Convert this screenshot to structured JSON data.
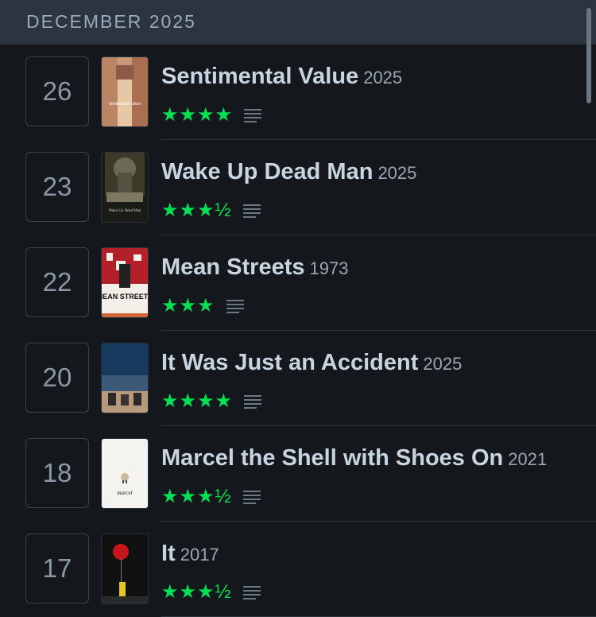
{
  "header": {
    "month": "DECEMBER 2025"
  },
  "entries": [
    {
      "day": "26",
      "title": "Sentimental Value",
      "year": "2025",
      "stars": "★★★★",
      "poster_text": "Sentimental Value"
    },
    {
      "day": "23",
      "title": "Wake Up Dead Man",
      "year": "2025",
      "stars": "★★★½",
      "poster_text": "Wake Up Dead Man"
    },
    {
      "day": "22",
      "title": "Mean Streets",
      "year": "1973",
      "stars": "★★★",
      "poster_text": "MEAN STREETS"
    },
    {
      "day": "20",
      "title": "It Was Just an Accident",
      "year": "2025",
      "stars": "★★★★",
      "poster_text": ""
    },
    {
      "day": "18",
      "title": "Marcel the Shell with Shoes On",
      "year": "2021",
      "stars": "★★★½",
      "poster_text": "marcel"
    },
    {
      "day": "17",
      "title": "It",
      "year": "2017",
      "stars": "★★★½",
      "poster_text": ""
    }
  ],
  "colors": {
    "background": "#14181c",
    "header": "#2c3440",
    "star": "#00e054",
    "title": "#c8d4e0"
  },
  "icons": [
    "review-lines-icon"
  ]
}
